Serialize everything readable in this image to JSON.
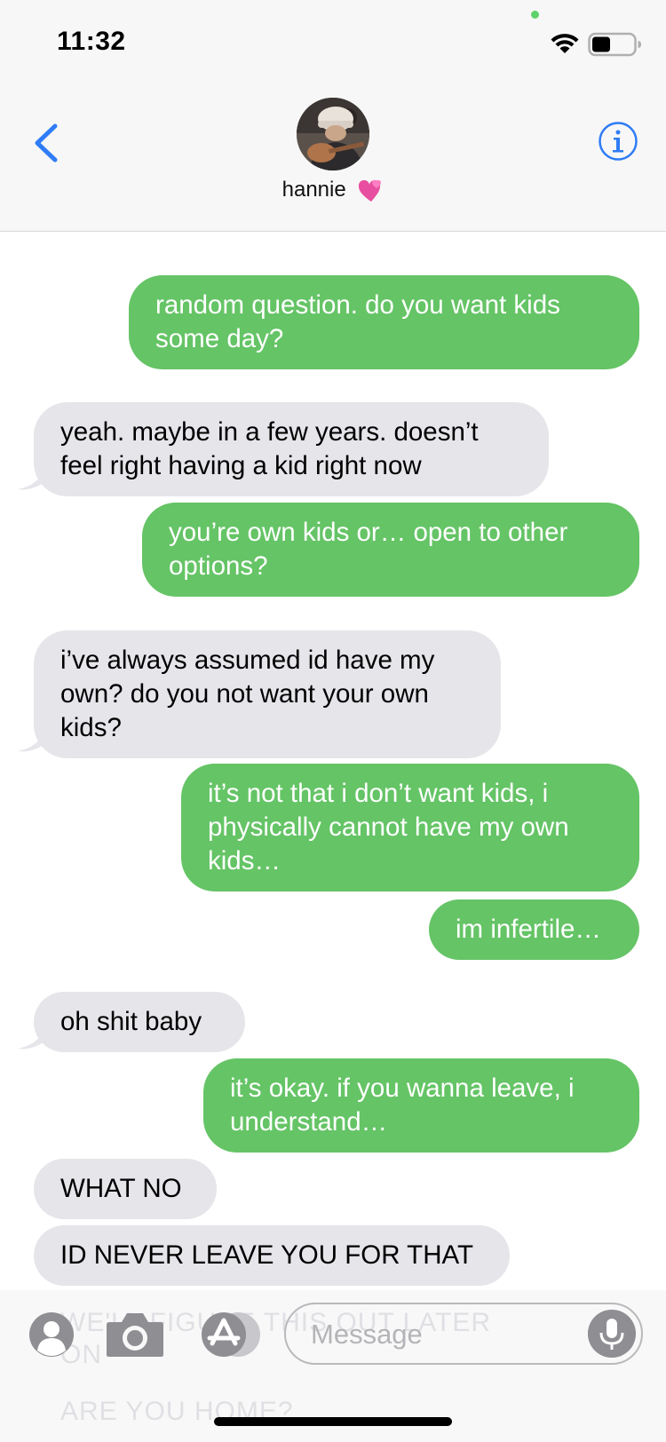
{
  "status": {
    "time": "11:32"
  },
  "contact": {
    "name": "hannie",
    "emoji": "💞"
  },
  "messages": [
    {
      "side": "sent",
      "text": "random question. do you want kids some day?"
    },
    {
      "side": "received",
      "text": "yeah. maybe in a few years. doesn’t feel right having a kid right now"
    },
    {
      "side": "sent",
      "text": "you’re own kids or… open to other options?"
    },
    {
      "side": "received",
      "text": "i’ve always assumed id have my own? do you not want your own kids?"
    },
    {
      "side": "sent",
      "text": "it’s not that i don’t want kids, i physically cannot have my own kids…"
    },
    {
      "side": "sent",
      "text": "im infertile…"
    },
    {
      "side": "received",
      "text": "oh shit baby"
    },
    {
      "side": "sent",
      "text": "it’s okay. if you wanna leave, i understand…"
    },
    {
      "side": "received",
      "text": "WHAT NO"
    },
    {
      "side": "received",
      "text": "ID NEVER LEAVE YOU FOR THAT"
    }
  ],
  "behind_input": {
    "line1": "WE'LL FIGURE THIS OUT LATER",
    "line2": "ON",
    "line3": "ARE YOU HOME?"
  },
  "input": {
    "placeholder": "Message"
  },
  "colors": {
    "sent_bubble": "#65c466",
    "received_bubble": "#e5e5ea",
    "accent": "#2f7cf6"
  },
  "icons": [
    "wifi-icon",
    "battery-icon",
    "back-chevron-icon",
    "info-icon",
    "contact-icon",
    "camera-icon",
    "app-store-icon",
    "mic-icon"
  ]
}
